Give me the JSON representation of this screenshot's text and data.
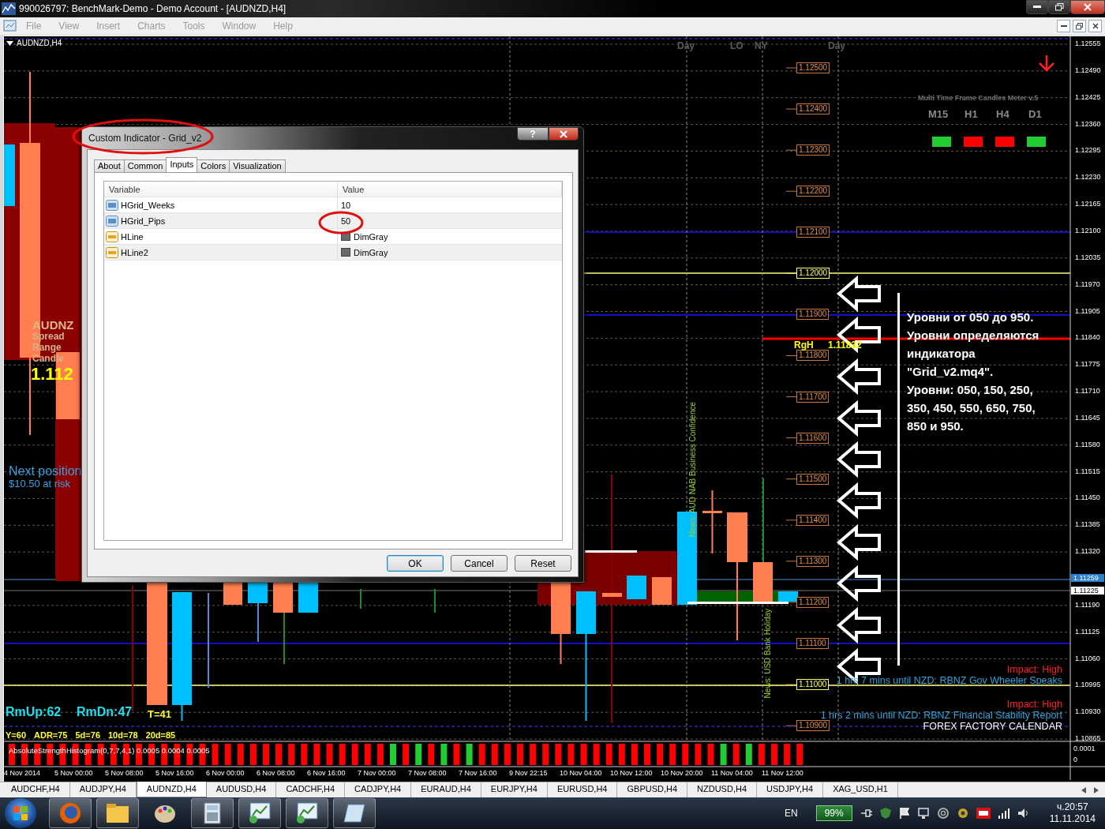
{
  "window": {
    "title": "990026797: BenchMark-Demo - Demo Account - [AUDNZD,H4]"
  },
  "menu": [
    "File",
    "View",
    "Insert",
    "Charts",
    "Tools",
    "Window",
    "Help"
  ],
  "chart": {
    "symbol": "AUDNZD,H4",
    "sessions": [
      "Day",
      "LO",
      "NY",
      "Day"
    ],
    "price_axis": [
      {
        "label": "1.12555",
        "kind": "tick"
      },
      {
        "label": "1.12490",
        "kind": "tick"
      },
      {
        "label": "1.12425",
        "kind": "tick"
      },
      {
        "label": "1.12360",
        "kind": "tick"
      },
      {
        "label": "1.12295",
        "kind": "tick"
      },
      {
        "label": "1.12230",
        "kind": "tick"
      },
      {
        "label": "1.12165",
        "kind": "tick"
      },
      {
        "label": "1.12100",
        "kind": "tick"
      },
      {
        "label": "1.12035",
        "kind": "tick"
      },
      {
        "label": "1.11970",
        "kind": "tick"
      },
      {
        "label": "1.11905",
        "kind": "tick"
      },
      {
        "label": "1.11840",
        "kind": "tick"
      },
      {
        "label": "1.11775",
        "kind": "tick"
      },
      {
        "label": "1.11710",
        "kind": "tick"
      },
      {
        "label": "1.11645",
        "kind": "tick"
      },
      {
        "label": "1.11580",
        "kind": "tick"
      },
      {
        "label": "1.11515",
        "kind": "tick"
      },
      {
        "label": "1.11450",
        "kind": "tick"
      },
      {
        "label": "1.11385",
        "kind": "tick"
      },
      {
        "label": "1.11320",
        "kind": "tick"
      },
      {
        "label": "1.11259",
        "kind": "bid"
      },
      {
        "label": "1.11225",
        "kind": "ask"
      },
      {
        "label": "1.11190",
        "kind": "tick"
      },
      {
        "label": "1.11125",
        "kind": "tick"
      },
      {
        "label": "1.11060",
        "kind": "tick"
      },
      {
        "label": "1.10995",
        "kind": "tick"
      },
      {
        "label": "1.10930",
        "kind": "tick"
      },
      {
        "label": "1.10865",
        "kind": "tick"
      }
    ],
    "grid_labels": [
      {
        "label": "1.12500",
        "kind": "level"
      },
      {
        "label": "1.12400",
        "kind": "level"
      },
      {
        "label": "1.12300",
        "kind": "level"
      },
      {
        "label": "1.12200",
        "kind": "level"
      },
      {
        "label": "1.12100",
        "kind": "level"
      },
      {
        "label": "1.12000",
        "kind": "major"
      },
      {
        "label": "1.11900",
        "kind": "level"
      },
      {
        "label": "1.11800",
        "kind": "level"
      },
      {
        "label": "1.11700",
        "kind": "level"
      },
      {
        "label": "1.11600",
        "kind": "level"
      },
      {
        "label": "1.11500",
        "kind": "level"
      },
      {
        "label": "1.11400",
        "kind": "level"
      },
      {
        "label": "1.11300",
        "kind": "level"
      },
      {
        "label": "1.11200",
        "kind": "level"
      },
      {
        "label": "1.11100",
        "kind": "level"
      },
      {
        "label": "1.11000",
        "kind": "major"
      },
      {
        "label": "1.10900",
        "kind": "level"
      }
    ],
    "mtf_meter": {
      "title": "Multi Time Frame Candles Meter v.5",
      "frames": [
        {
          "label": "M15",
          "color": "#22cc33"
        },
        {
          "label": "H1",
          "color": "#ff0000"
        },
        {
          "label": "H4",
          "color": "#ff0000"
        },
        {
          "label": "D1",
          "color": "#22cc33"
        }
      ]
    },
    "range_high": {
      "label": "RgH",
      "price": "1.11832"
    },
    "annotation": [
      "Уровни от 050 до 950.",
      "Уровни определяются",
      "индикатора",
      "\"Grid_v2.mq4\".",
      "Уровни: 050, 150, 250,",
      "350, 450, 550, 650, 750,",
      "850 и 950."
    ],
    "info": {
      "symbol": "AUDNZ",
      "rows": [
        "Spread",
        "Range",
        "Candle"
      ],
      "price": "1.112"
    },
    "position": {
      "title": "Next position",
      "risk": "$10.50 at risk"
    },
    "news": [
      "News: AUD NAB Business Confidence",
      "News: USD Bank Holiday"
    ],
    "calendar": [
      {
        "kind": "impact",
        "text": "Impact: High"
      },
      {
        "kind": "event",
        "text": "1 hrs 7 mins until NZD: RBNZ Gov Wheeler Speaks"
      },
      {
        "kind": "impact",
        "text": "Impact: High"
      },
      {
        "kind": "event",
        "text": "1 hrs 2 mins until NZD: RBNZ Financial Stability Report"
      },
      {
        "kind": "title",
        "text": "FOREX FACTORY CALENDAR"
      }
    ],
    "range_stats": [
      {
        "kind": "range",
        "text": "RmUp:62"
      },
      {
        "kind": "range",
        "text": "RmDn:47"
      },
      {
        "kind": "time",
        "text": "T=41"
      }
    ],
    "adr_stats": [
      "Y=60",
      "ADR=75",
      "5d=76",
      "10d=78",
      "20d=85"
    ],
    "indicator": {
      "label": "AbsoluteStrengthHistogram(0,7,7,4,1) 0.0005 0.0004 0.0005",
      "axis": [
        "0.0001",
        "0"
      ]
    },
    "time_axis": [
      "4 Nov 2014",
      "5 Nov 00:00",
      "5 Nov 08:00",
      "5 Nov 16:00",
      "6 Nov 00:00",
      "6 Nov 08:00",
      "6 Nov 16:00",
      "7 Nov 00:00",
      "7 Nov 08:00",
      "7 Nov 16:00",
      "9 Nov 22:15",
      "10 Nov 04:00",
      "10 Nov 12:00",
      "10 Nov 20:00",
      "11 Nov 04:00",
      "11 Nov 12:00"
    ]
  },
  "dialog": {
    "title": "Custom Indicator - Grid_v2",
    "help": "?",
    "tabs": [
      {
        "label": "About",
        "selected": false
      },
      {
        "label": "Common",
        "selected": false
      },
      {
        "label": "Inputs",
        "selected": true
      },
      {
        "label": "Colors",
        "selected": false
      },
      {
        "label": "Visualization",
        "selected": false
      }
    ],
    "columns": [
      "Variable",
      "Value"
    ],
    "rows": [
      {
        "name": "HGrid_Weeks",
        "value": "10",
        "kind": "number"
      },
      {
        "name": "HGrid_Pips",
        "value": "50",
        "kind": "number"
      },
      {
        "name": "HLine",
        "value": "DimGray",
        "kind": "color",
        "color": "#696969"
      },
      {
        "name": "HLine2",
        "value": "DimGray",
        "kind": "color",
        "color": "#696969"
      }
    ],
    "buttons": [
      "OK",
      "Cancel",
      "Reset"
    ]
  },
  "symbol_tabs": [
    {
      "label": "AUDCHF,H4",
      "selected": false
    },
    {
      "label": "AUDJPY,H4",
      "selected": false
    },
    {
      "label": "AUDNZD,H4",
      "selected": true
    },
    {
      "label": "AUDUSD,H4",
      "selected": false
    },
    {
      "label": "CADCHF,H4",
      "selected": false
    },
    {
      "label": "CADJPY,H4",
      "selected": false
    },
    {
      "label": "EURAUD,H4",
      "selected": false
    },
    {
      "label": "EURJPY,H4",
      "selected": false
    },
    {
      "label": "EURUSD,H4",
      "selected": false
    },
    {
      "label": "GBPUSD,H4",
      "selected": false
    },
    {
      "label": "NZDUSD,H4",
      "selected": false
    },
    {
      "label": "USDJPY,H4",
      "selected": false
    },
    {
      "label": "XAG_USD,H1",
      "selected": false
    }
  ],
  "taskbar": {
    "language": "EN",
    "battery": "99%",
    "time": "ч.20:57",
    "date": "11.11.2014"
  }
}
